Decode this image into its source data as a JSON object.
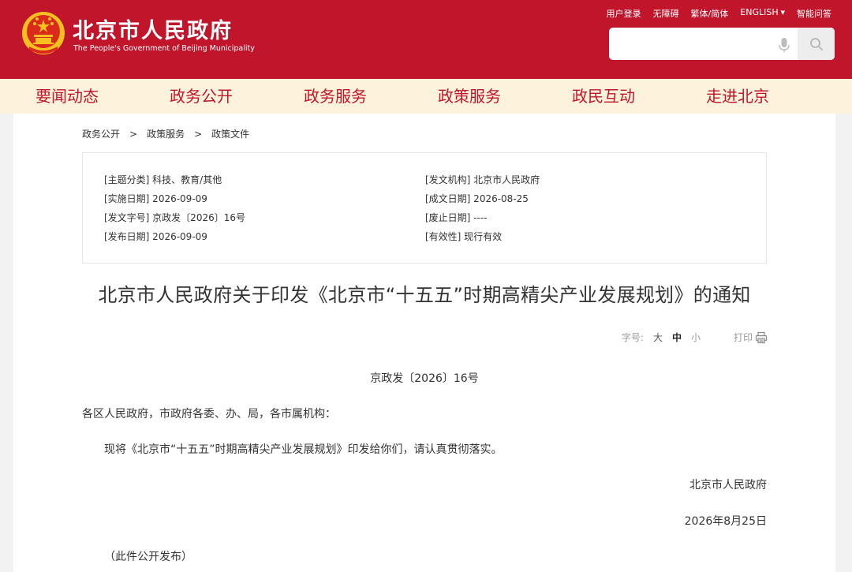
{
  "header": {
    "title": "北京市人民政府",
    "subtitle": "The People's Government of Beijing Municipality",
    "links": [
      "用户登录",
      "无障碍",
      "繁体/简体",
      "ENGLISH",
      "智能问答"
    ]
  },
  "search": {
    "placeholder": ""
  },
  "nav": [
    "要闻动态",
    "政务公开",
    "政务服务",
    "政策服务",
    "政民互动",
    "走进北京"
  ],
  "breadcrumb": [
    "政务公开",
    "政策服务",
    "政策文件"
  ],
  "meta": {
    "left": [
      "[主题分类] 科技、教育/其他",
      "[实施日期] 2026-09-09",
      "[发文字号] 京政发〔2026〕16号",
      "[发布日期] 2026-09-09"
    ],
    "right": [
      "[发文机构] 北京市人民政府",
      "[成文日期] 2026-08-25",
      "[废止日期] ----",
      "[有效性] 现行有效"
    ]
  },
  "document": {
    "title": "北京市人民政府关于印发《北京市“十五五”时期高精尖产业发展规划》的通知",
    "number": "京政发〔2026〕16号",
    "addressee": "各区人民政府，市政府各委、办、局，各市属机构：",
    "body": "现将《北京市“十五五”时期高精尖产业发展规划》印发给你们，请认真贯彻落实。",
    "signature": "北京市人民政府",
    "date": "2026年8月25日",
    "note": "（此件公开发布）"
  },
  "tools": {
    "font_label": "字号:",
    "size_large": "大",
    "size_medium": "中",
    "size_small": "小",
    "print_label": "打印"
  },
  "colors": {
    "brand_red": "#c0152b",
    "nav_bg": "#fdf3dd",
    "emblem_gold": "#f5c020"
  }
}
